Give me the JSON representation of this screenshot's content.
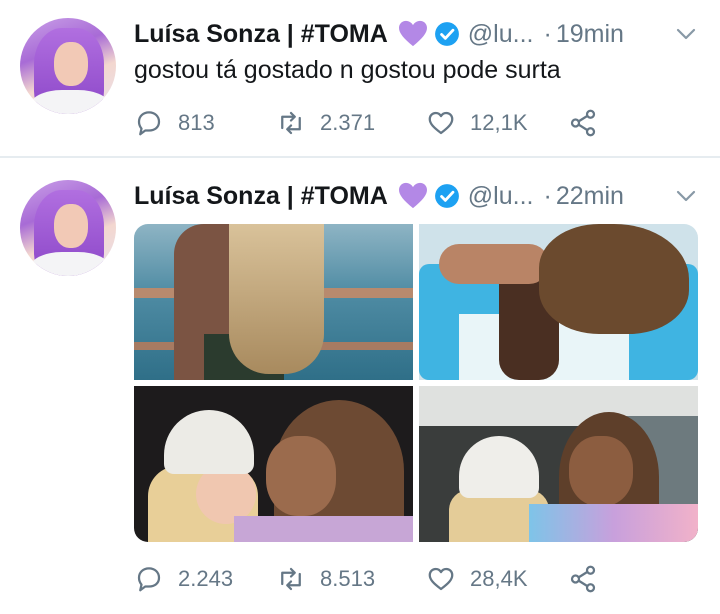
{
  "tweets": [
    {
      "author": {
        "name": "Luísa Sonza | #TOMA",
        "handle": "@lu...",
        "time": "19min"
      },
      "dot": "·",
      "text": "gostou tá gostado n gostou pode surta",
      "stats": {
        "replies": "813",
        "retweets": "2.371",
        "likes": "12,1K"
      }
    },
    {
      "author": {
        "name": "Luísa Sonza | #TOMA",
        "handle": "@lu...",
        "time": "22min"
      },
      "dot": "·",
      "text": "",
      "stats": {
        "replies": "2.243",
        "retweets": "8.513",
        "likes": "28,4K"
      },
      "media_count": 4
    }
  ],
  "colors": {
    "accent": "#1da1f2",
    "secondary_text": "#657786",
    "heart_emoji": "#b388e6",
    "divider": "#e6ecf0"
  },
  "icons": [
    "reply-icon",
    "retweet-icon",
    "like-icon",
    "share-icon",
    "verified-badge-icon",
    "purple-heart-icon",
    "chevron-down-icon"
  ]
}
